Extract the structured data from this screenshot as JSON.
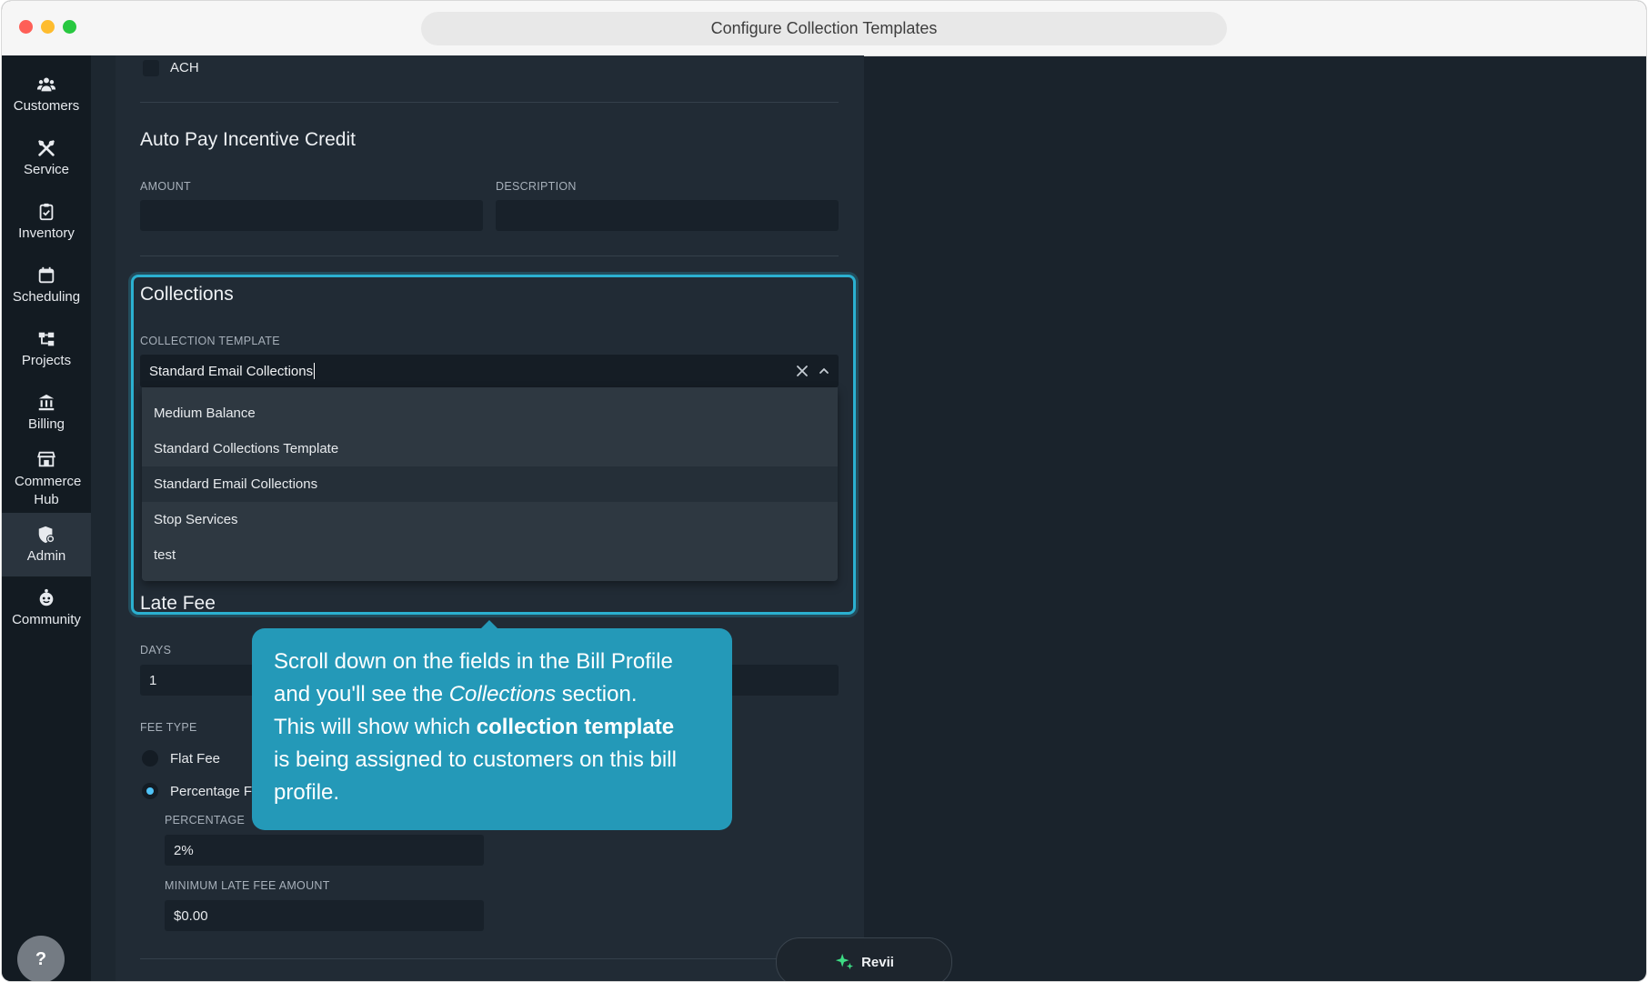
{
  "window": {
    "title": "Configure Collection Templates"
  },
  "sidebar": {
    "items": [
      {
        "label": "Customers",
        "icon": "customers-icon"
      },
      {
        "label": "Service",
        "icon": "tools-icon"
      },
      {
        "label": "Inventory",
        "icon": "clipboard-icon"
      },
      {
        "label": "Scheduling",
        "icon": "calendar-icon"
      },
      {
        "label": "Projects",
        "icon": "projects-icon"
      },
      {
        "label": "Billing",
        "icon": "bank-icon"
      },
      {
        "label": "Commerce Hub",
        "icon": "store-icon"
      },
      {
        "label": "Admin",
        "icon": "admin-shield-icon",
        "active": true
      },
      {
        "label": "Community",
        "icon": "community-icon"
      }
    ],
    "help_label": "?"
  },
  "form": {
    "ach_label": "ACH",
    "autopay": {
      "title": "Auto Pay Incentive Credit",
      "amount_label": "AMOUNT",
      "amount_value": "",
      "description_label": "DESCRIPTION",
      "description_value": ""
    },
    "collections": {
      "title": "Collections",
      "template_label": "COLLECTION TEMPLATE",
      "template_value": "Standard Email Collections",
      "options": [
        "Medium Balance",
        "Standard Collections Template",
        "Standard Email Collections",
        "Stop Services",
        "test"
      ],
      "selected_index": 2
    },
    "late_fee": {
      "title": "Late Fee",
      "days_label": "DAYS",
      "days_value": "1",
      "fee_type_label": "FEE TYPE",
      "flat_fee_label": "Flat Fee",
      "percentage_label": "Percentage F",
      "percentage_field_label": "PERCENTAGE",
      "percentage_value": "2%",
      "min_label": "MINIMUM LATE FEE AMOUNT",
      "min_value": "$0.00"
    }
  },
  "tooltip": {
    "line1": "Scroll down on the fields in the Bill Profile",
    "line2a": "and you'll see the ",
    "line2_em": "Collections",
    "line2b": " section.",
    "line3a": "This will show which ",
    "line3_strong": "collection template",
    "line4": "is being assigned to customers on this bill",
    "line5": "profile."
  },
  "assistant": {
    "label": "Revii",
    "icon": "sparkle-icon"
  },
  "colors": {
    "accent": "#2bb0d0",
    "tooltip_bg": "#2499b8",
    "panel_bg": "#212b35",
    "sidebar_bg": "#131b22",
    "radio_on": "#4fc3f7",
    "sparkle": "#3ddc84"
  }
}
